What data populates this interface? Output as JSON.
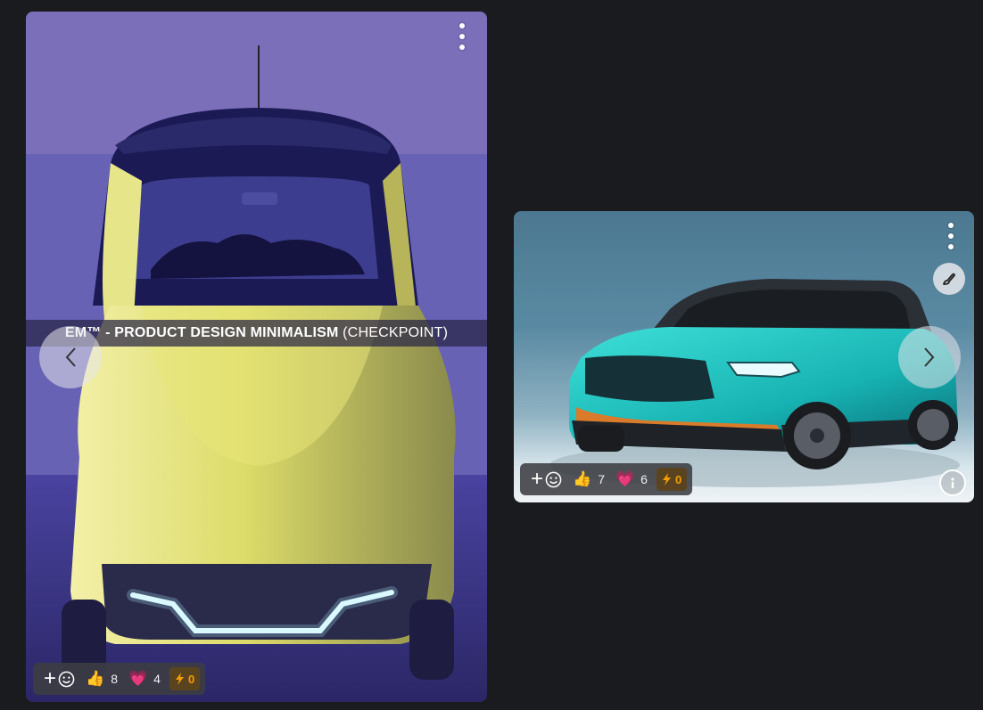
{
  "cards": [
    {
      "banner": {
        "brand": "EM™ - PRODUCT DESIGN MINIMALISM",
        "suffix": "(CHECKPOINT)"
      },
      "reactions": [
        {
          "emoji": "👍",
          "icon": "thumbs-up",
          "count": "8"
        },
        {
          "emoji": "💗",
          "icon": "heart",
          "count": "4"
        }
      ],
      "tip_count": "0"
    },
    {
      "reactions": [
        {
          "emoji": "👍",
          "icon": "thumbs-up",
          "count": "7"
        },
        {
          "emoji": "💗",
          "icon": "heart",
          "count": "6"
        }
      ],
      "tip_count": "0"
    }
  ],
  "colors": {
    "background": "#1a1b1e",
    "tip_accent": "#f59f00",
    "tip_bg": "#5a4420"
  }
}
